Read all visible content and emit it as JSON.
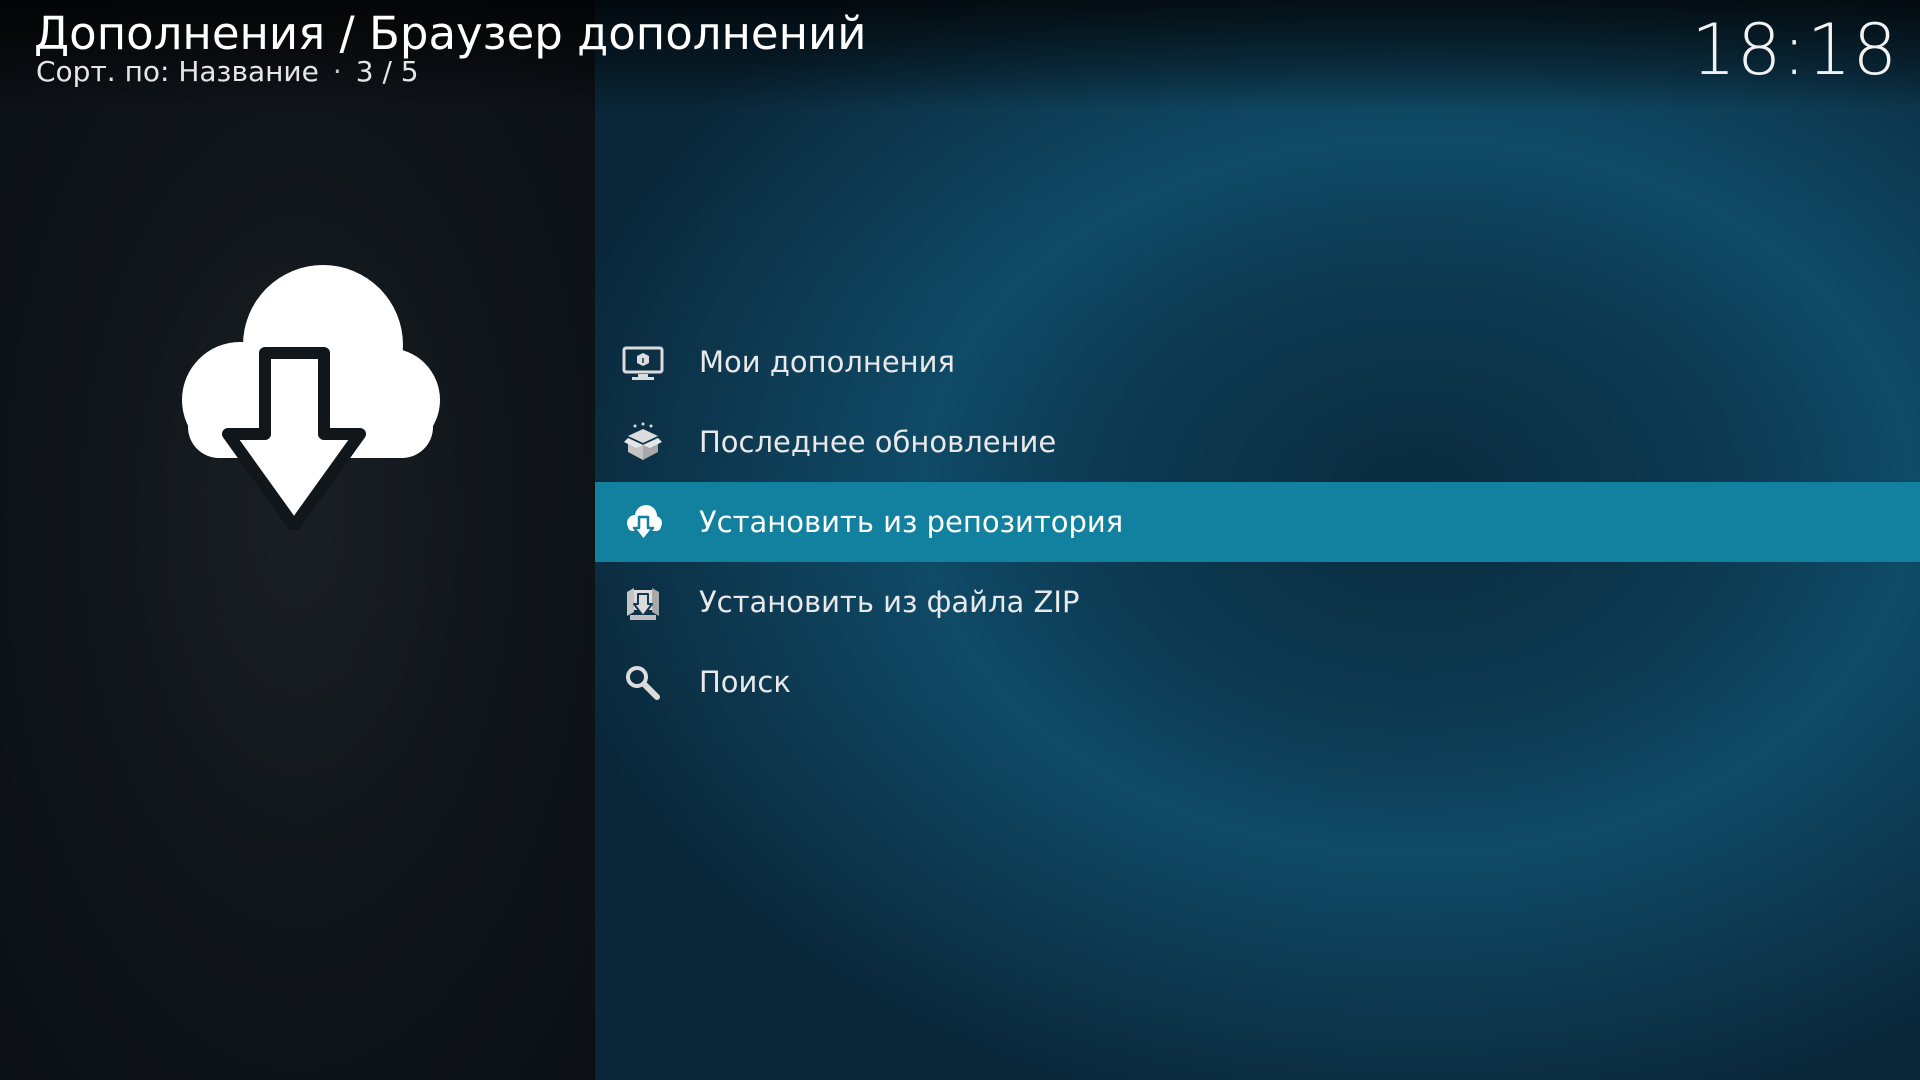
{
  "header": {
    "title": "Дополнения / Браузер дополнений",
    "sort_label": "Сорт. по: Название",
    "separator": "·",
    "position": "3 / 5"
  },
  "clock": "18:18",
  "hero": {
    "icon": "cloud-download-icon"
  },
  "menu": {
    "selected_index": 2,
    "items": [
      {
        "label": "Мои дополнения",
        "icon": "monitor-box-icon"
      },
      {
        "label": "Последнее обновление",
        "icon": "open-box-icon"
      },
      {
        "label": "Установить из репозитория",
        "icon": "cloud-download-icon"
      },
      {
        "label": "Установить из файла ZIP",
        "icon": "zip-install-icon"
      },
      {
        "label": "Поиск",
        "icon": "search-icon"
      }
    ]
  },
  "colors": {
    "selected_bg": "#12809f",
    "right_bg": "#0f4a66",
    "left_bg": "#11161b",
    "text": "#ffffff"
  }
}
